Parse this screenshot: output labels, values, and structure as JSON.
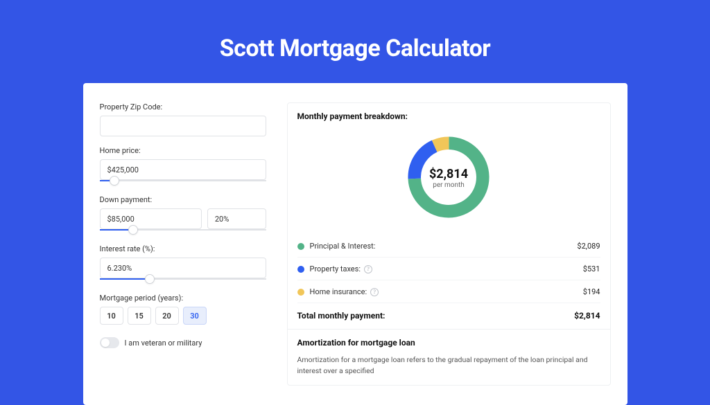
{
  "title": "Scott Mortgage Calculator",
  "form": {
    "zip_label": "Property Zip Code:",
    "zip_value": "",
    "home_price_label": "Home price:",
    "home_price_value": "$425,000",
    "home_price_slider_pct": 9,
    "down_payment_label": "Down payment:",
    "down_payment_value": "$85,000",
    "down_payment_pct_value": "20%",
    "down_payment_slider_pct": 20,
    "interest_label": "Interest rate (%):",
    "interest_value": "6.230%",
    "interest_slider_pct": 30,
    "period_label": "Mortgage period (years):",
    "periods": [
      "10",
      "15",
      "20",
      "30"
    ],
    "period_selected_index": 3,
    "veteran_label": "I am veteran or military"
  },
  "breakdown": {
    "title": "Monthly payment breakdown:",
    "total_amount": "$2,814",
    "per_month": "per month",
    "items": [
      {
        "label": "Principal & Interest:",
        "value": "$2,089",
        "color": "#53b388",
        "has_info": false
      },
      {
        "label": "Property taxes:",
        "value": "$531",
        "color": "#2f5ff0",
        "has_info": true
      },
      {
        "label": "Home insurance:",
        "value": "$194",
        "color": "#f1c659",
        "has_info": true
      }
    ],
    "total_label": "Total monthly payment:",
    "total_value": "$2,814"
  },
  "amortization": {
    "title": "Amortization for mortgage loan",
    "text": "Amortization for a mortgage loan refers to the gradual repayment of the loan principal and interest over a specified"
  },
  "chart_data": {
    "type": "pie",
    "title": "Monthly payment breakdown",
    "categories": [
      "Principal & Interest",
      "Property taxes",
      "Home insurance"
    ],
    "values": [
      2089,
      531,
      194
    ],
    "colors": [
      "#53b388",
      "#2f5ff0",
      "#f1c659"
    ],
    "center_label": "$2,814 per month"
  }
}
